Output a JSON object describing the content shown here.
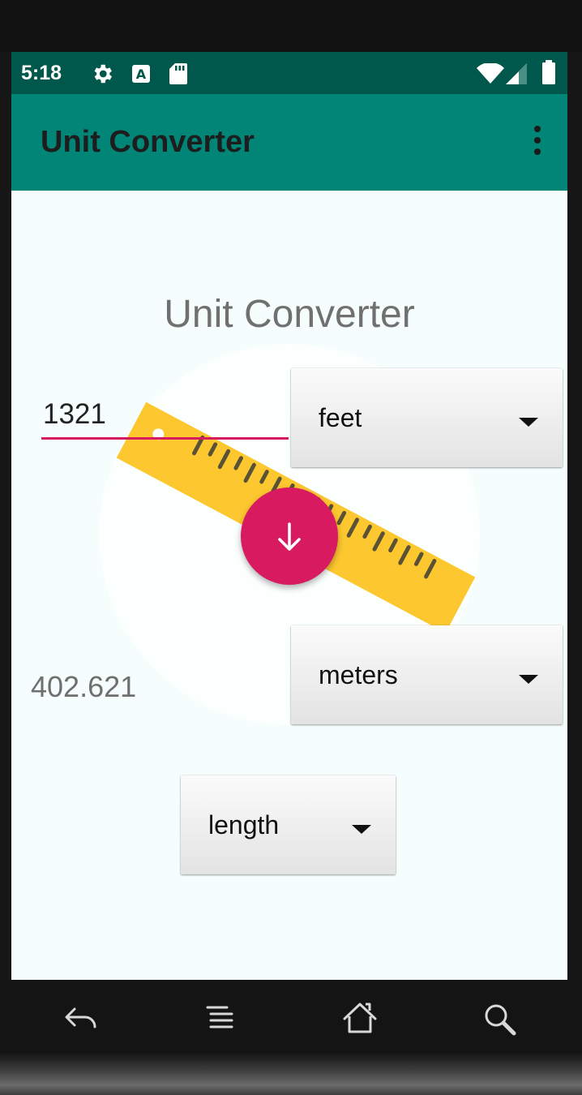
{
  "status_bar": {
    "time": "5:18",
    "icons": [
      "settings-icon",
      "keyboard-a-icon",
      "sd-card-icon",
      "wifi-icon",
      "signal-icon",
      "battery-icon"
    ]
  },
  "app_bar": {
    "title": "Unit Converter",
    "menu_icon": "more-vert-icon"
  },
  "main": {
    "headline": "Unit Converter",
    "input_value": "1321",
    "from_unit": "feet",
    "to_unit": "meters",
    "result": "402.621",
    "category": "length",
    "convert_icon": "arrow-down-icon"
  },
  "colors": {
    "status_bar": "#00574b",
    "app_bar": "#008577",
    "accent": "#d81b60",
    "ruler": "#fdc72f"
  },
  "nav_bar": {
    "icons": [
      "back-icon",
      "menu-icon",
      "home-icon",
      "search-icon"
    ]
  }
}
